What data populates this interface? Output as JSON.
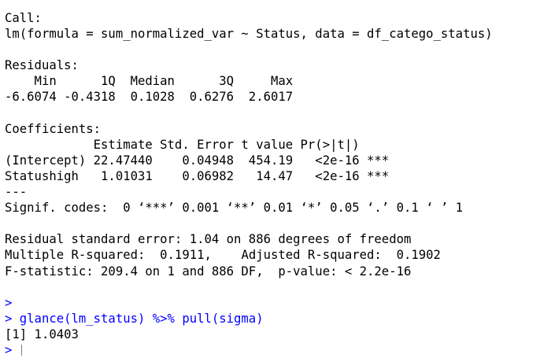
{
  "console": {
    "output_lines": [
      "Call:",
      "lm(formula = sum_normalized_var ~ Status, data = df_catego_status)",
      "",
      "Residuals:",
      "    Min      1Q  Median      3Q     Max ",
      "-6.6074 -0.4318  0.1028  0.6276  2.6017 ",
      "",
      "Coefficients:",
      "            Estimate Std. Error t value Pr(>|t|)    ",
      "(Intercept) 22.47440    0.04948  454.19   <2e-16 ***",
      "Statushigh   1.01031    0.06982   14.47   <2e-16 ***",
      "---",
      "Signif. codes:  0 ‘***’ 0.001 ‘**’ 0.01 ‘*’ 0.05 ‘.’ 0.1 ‘ ’ 1",
      "",
      "Residual standard error: 1.04 on 886 degrees of freedom",
      "Multiple R-squared:  0.1911,\tAdjusted R-squared:  0.1902 ",
      "F-statistic: 209.4 on 1 and 886 DF,  p-value: < 2.2e-16",
      ""
    ],
    "prompt_empty": ">",
    "command": "> glance(lm_status) %>% pull(sigma)",
    "result": "[1] 1.0403",
    "prompt_current": "> ",
    "colors": {
      "text": "#000000",
      "prompt": "#0000ff",
      "cursor": "#7f7f7f"
    }
  }
}
